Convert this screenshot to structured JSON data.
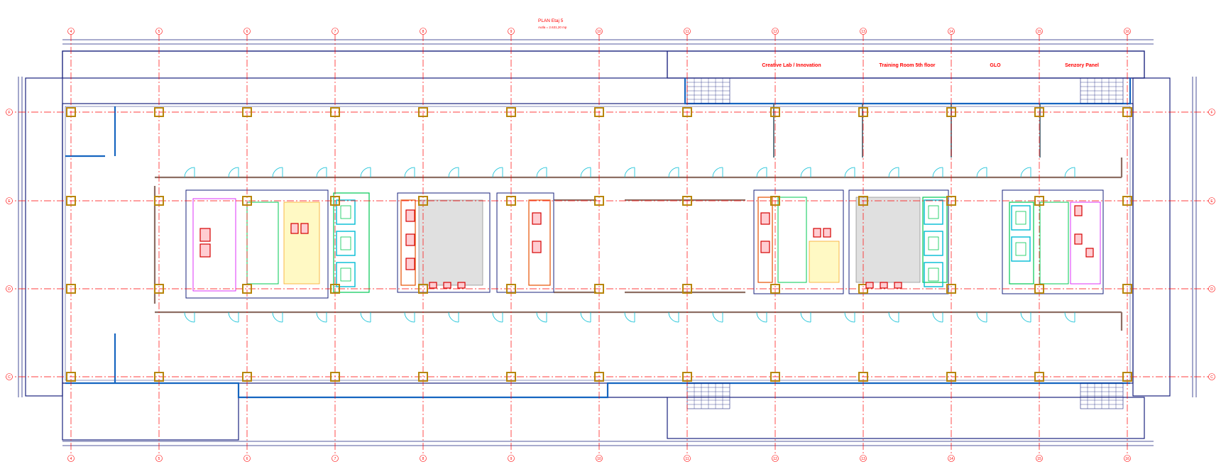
{
  "plan": {
    "title": "PLAN  Etaj 5",
    "subtitle": "Autla = 2.631,20 mp"
  },
  "axes": {
    "columns": [
      "4",
      "5",
      "6",
      "7",
      "8",
      "9",
      "10",
      "11",
      "12",
      "13",
      "14",
      "15",
      "16"
    ],
    "rows": [
      "F",
      "E",
      "D",
      "C"
    ]
  },
  "rooms": [
    {
      "label": "Creative Lab / Innovation"
    },
    {
      "label": "Training Room 5th floor"
    },
    {
      "label": "GLO"
    },
    {
      "label": "Senzory Panel"
    }
  ],
  "colors": {
    "axis": "#ff0000",
    "outline": "#1a237e",
    "wall_inner": "#1565c0",
    "partition": "#e65100",
    "column": "#b8860b",
    "cyan": "#00bcd4",
    "green": "#00c853",
    "magenta": "#d500f9"
  }
}
